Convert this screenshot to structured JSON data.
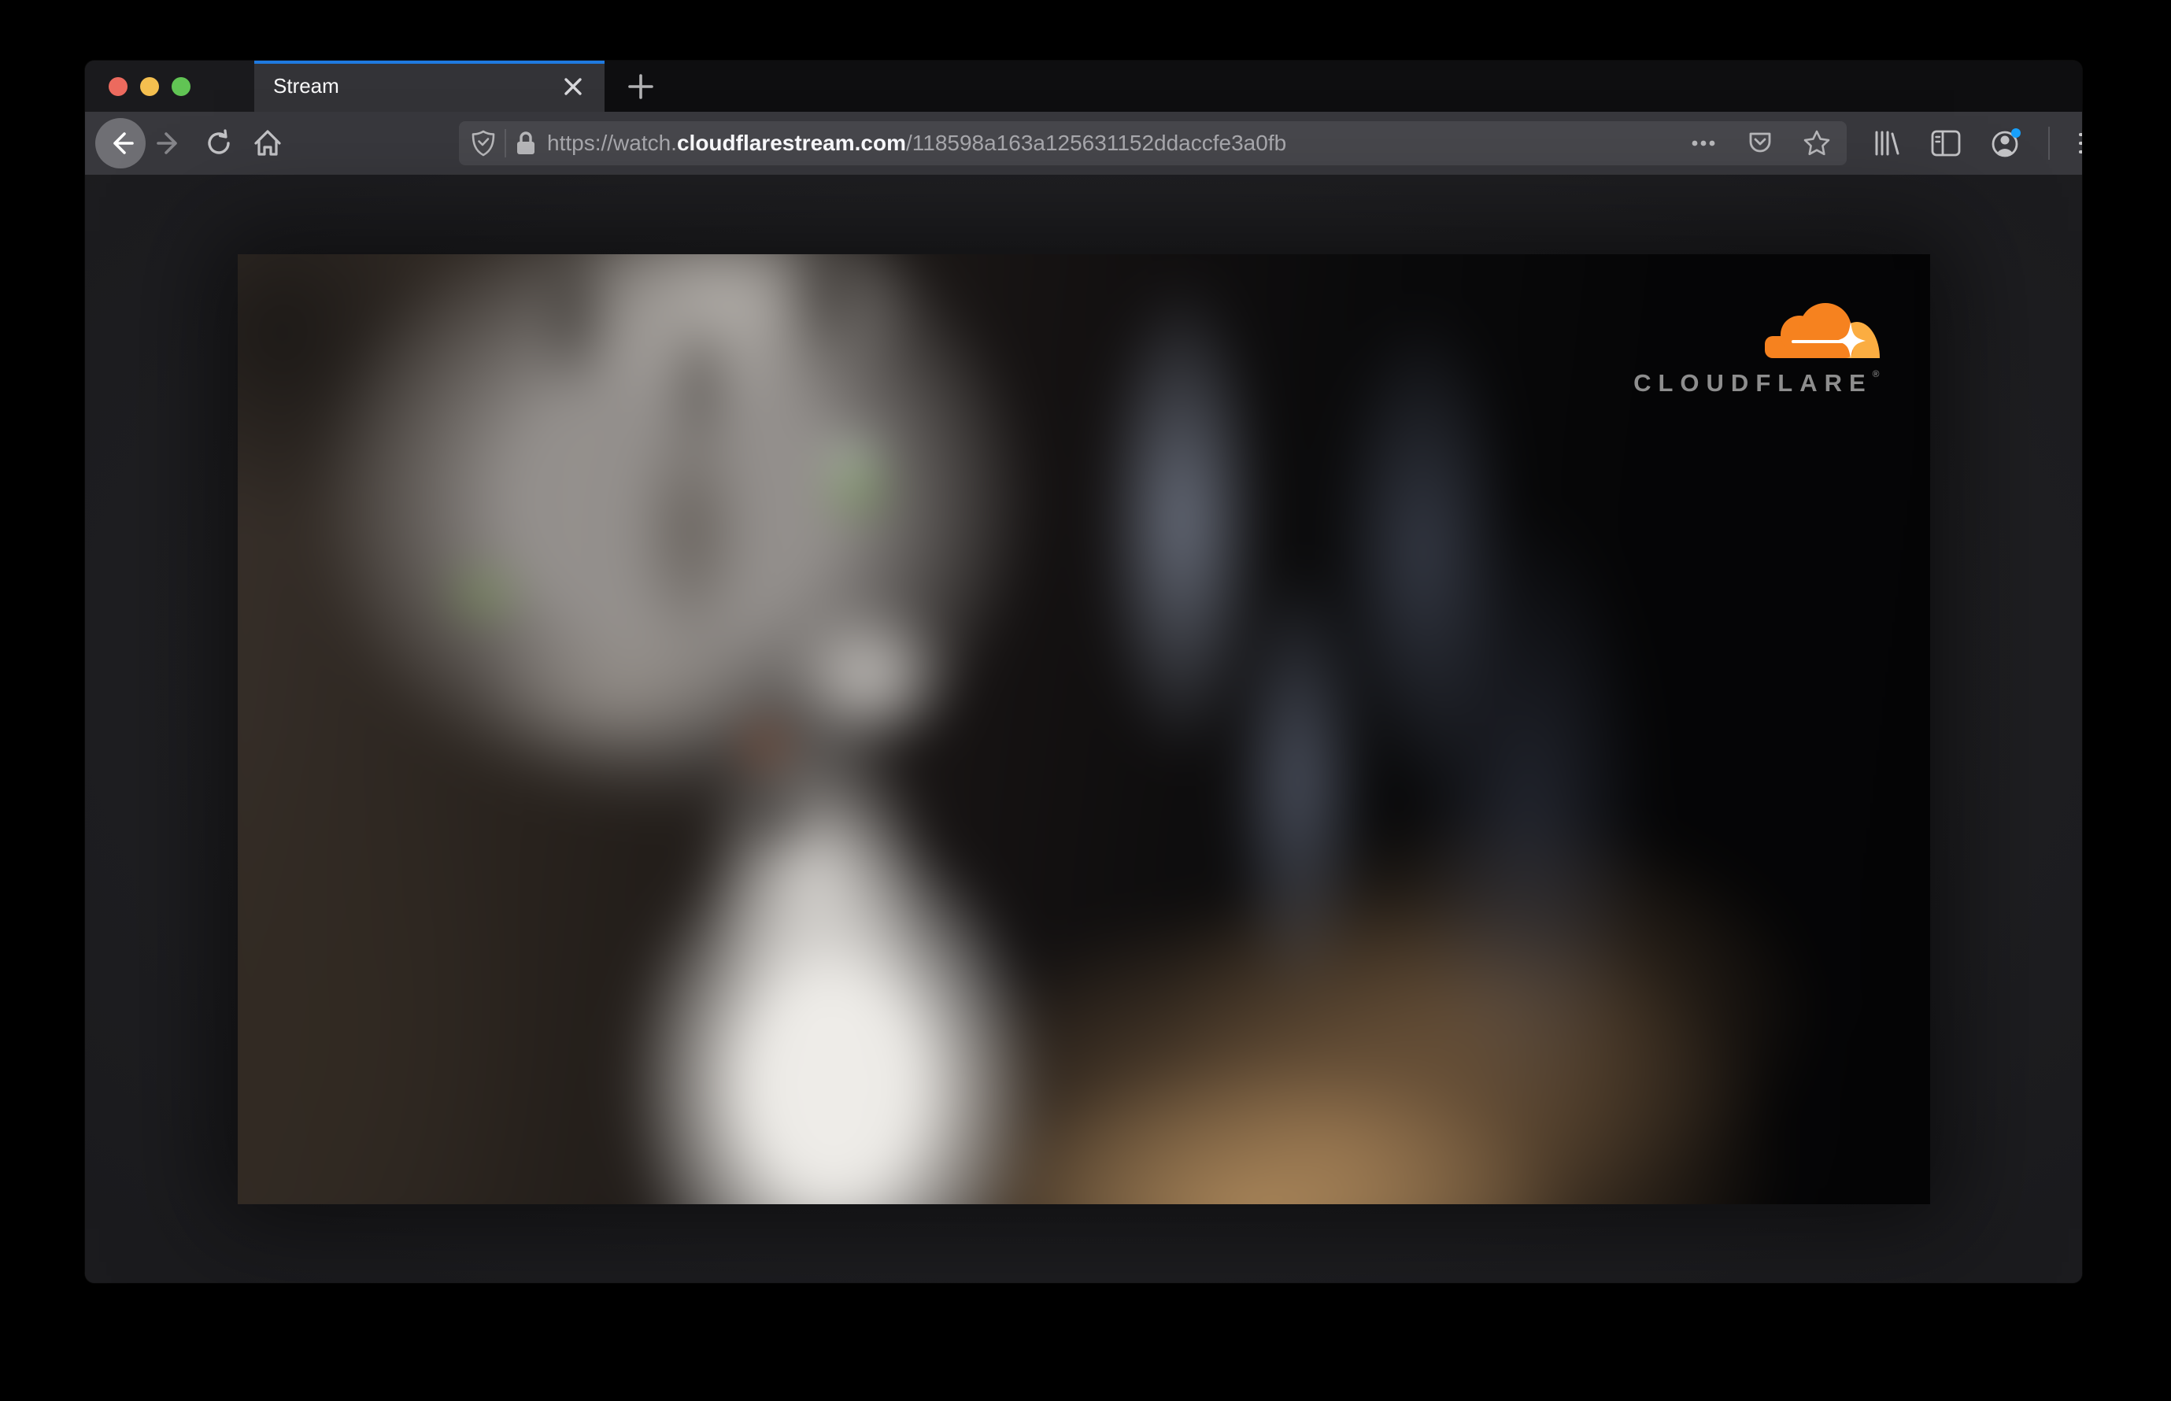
{
  "tabbar": {
    "active_tab_title": "Stream"
  },
  "navbar": {
    "url": {
      "scheme_and_subdomain": "https://watch.",
      "highlighted_domain": "cloudflarestream.com",
      "path": "/118598a163a125631152ddaccfe3a0fb"
    }
  },
  "page": {
    "brand": {
      "text": "CLOUDFLARE",
      "trademark": "®"
    }
  },
  "icons": {
    "traffic_lights": [
      "close-window",
      "minimize-window",
      "zoom-window"
    ],
    "tab": [
      "close-tab-x",
      "new-tab-plus"
    ],
    "nav_left": [
      "back-arrow",
      "forward-arrow",
      "reload",
      "home"
    ],
    "urlbar_left": [
      "tracking-protection-shield",
      "https-lock"
    ],
    "urlbar_right": [
      "page-actions-dots",
      "pocket-save",
      "bookmark-star"
    ],
    "toolbar_right": [
      "library",
      "sidebar",
      "account-with-notification-dot",
      "menu-hamburger"
    ],
    "video": [
      "cloudflare-cloud-logo"
    ]
  },
  "colors": {
    "accent_blue": "#1f7ae0",
    "notification_blue": "#18a0fb",
    "cloudflare_orange": "#f6821f",
    "cloudflare_light_orange": "#fbad41",
    "traffic_red": "#ec6a5e",
    "traffic_yellow": "#f4bf4f",
    "traffic_green": "#61c454",
    "toolbar_bg": "#38383d",
    "urlbar_bg": "#47474c",
    "tab_bg": "#333337",
    "page_bg": "#202023"
  }
}
